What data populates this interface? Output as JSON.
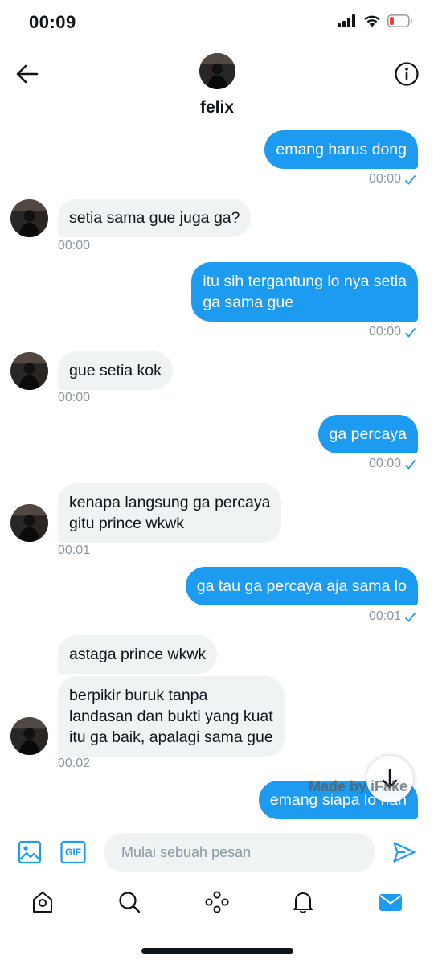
{
  "status_bar": {
    "time": "00:09"
  },
  "header": {
    "contact_name": "felix"
  },
  "messages": [
    {
      "side": "out",
      "text": "emang harus dong",
      "time": "00:00"
    },
    {
      "side": "in",
      "text": "setia sama gue juga ga?",
      "time": "00:00"
    },
    {
      "side": "out",
      "lines": [
        "itu sih tergantung lo nya setia",
        "ga sama gue"
      ],
      "time": "00:00"
    },
    {
      "side": "in",
      "text": "gue setia kok",
      "time": "00:00"
    },
    {
      "side": "out",
      "text": "ga percaya",
      "time": "00:00"
    },
    {
      "side": "in",
      "lines": [
        "kenapa langsung ga percaya",
        "gitu prince wkwk"
      ],
      "time": "00:01"
    },
    {
      "side": "out",
      "text": "ga tau ga percaya aja sama lo",
      "time": "00:01"
    },
    {
      "side": "in",
      "text": "astaga prince wkwk"
    },
    {
      "side": "in",
      "lines": [
        "berpikir buruk tanpa",
        "landasan dan bukti yang kuat",
        "itu ga baik, apalagi sama gue"
      ],
      "time": "00:02"
    },
    {
      "side": "out",
      "text": "emang siapa lo hah"
    }
  ],
  "watermark": "Made by iFake",
  "composer": {
    "placeholder": "Mulai sebuah pesan",
    "gif_label": "GIF"
  },
  "icons": {
    "back": "arrow-left-icon",
    "info": "info-icon",
    "read_receipt": "checkmark-icon",
    "scroll_down": "arrow-down-icon",
    "image": "image-icon",
    "gif": "gif-icon",
    "send": "send-icon",
    "tabs": [
      "home-icon",
      "search-icon",
      "spaces-icon",
      "notifications-icon",
      "messages-icon"
    ]
  },
  "colors": {
    "accent": "#1d9bf0",
    "incoming_bubble": "#eff3f4",
    "meta_text": "#8a959e",
    "text": "#0f1419"
  }
}
